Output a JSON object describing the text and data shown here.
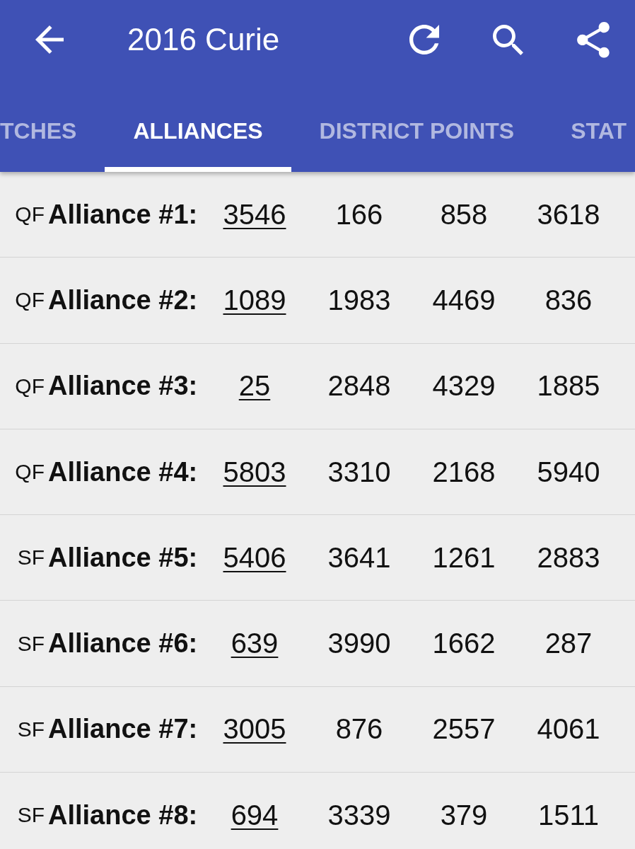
{
  "toolbar": {
    "title": "2016 Curie"
  },
  "tabs": [
    {
      "label": "TCHES",
      "selected": false
    },
    {
      "label": "ALLIANCES",
      "selected": true
    },
    {
      "label": "DISTRICT POINTS",
      "selected": false
    },
    {
      "label": "STAT",
      "selected": false
    }
  ],
  "alliances": [
    {
      "round": "QF",
      "name": "Alliance #1:",
      "teams": [
        {
          "number": "3546",
          "link": true
        },
        {
          "number": "166",
          "link": false
        },
        {
          "number": "858",
          "link": false
        },
        {
          "number": "3618",
          "link": false
        }
      ]
    },
    {
      "round": "QF",
      "name": "Alliance #2:",
      "teams": [
        {
          "number": "1089",
          "link": true
        },
        {
          "number": "1983",
          "link": false
        },
        {
          "number": "4469",
          "link": false
        },
        {
          "number": "836",
          "link": false
        }
      ]
    },
    {
      "round": "QF",
      "name": "Alliance #3:",
      "teams": [
        {
          "number": "25",
          "link": true
        },
        {
          "number": "2848",
          "link": false
        },
        {
          "number": "4329",
          "link": false
        },
        {
          "number": "1885",
          "link": false
        }
      ]
    },
    {
      "round": "QF",
      "name": "Alliance #4:",
      "teams": [
        {
          "number": "5803",
          "link": true
        },
        {
          "number": "3310",
          "link": false
        },
        {
          "number": "2168",
          "link": false
        },
        {
          "number": "5940",
          "link": false
        }
      ]
    },
    {
      "round": "SF",
      "name": "Alliance #5:",
      "teams": [
        {
          "number": "5406",
          "link": true
        },
        {
          "number": "3641",
          "link": false
        },
        {
          "number": "1261",
          "link": false
        },
        {
          "number": "2883",
          "link": false
        }
      ]
    },
    {
      "round": "SF",
      "name": "Alliance #6:",
      "teams": [
        {
          "number": "639",
          "link": true
        },
        {
          "number": "3990",
          "link": false
        },
        {
          "number": "1662",
          "link": false
        },
        {
          "number": "287",
          "link": false
        }
      ]
    },
    {
      "round": "SF",
      "name": "Alliance #7:",
      "teams": [
        {
          "number": "3005",
          "link": true
        },
        {
          "number": "876",
          "link": false
        },
        {
          "number": "2557",
          "link": false
        },
        {
          "number": "4061",
          "link": false
        }
      ]
    },
    {
      "round": "SF",
      "name": "Alliance #8:",
      "teams": [
        {
          "number": "694",
          "link": true
        },
        {
          "number": "3339",
          "link": false
        },
        {
          "number": "379",
          "link": false
        },
        {
          "number": "1511",
          "link": false
        }
      ]
    }
  ]
}
